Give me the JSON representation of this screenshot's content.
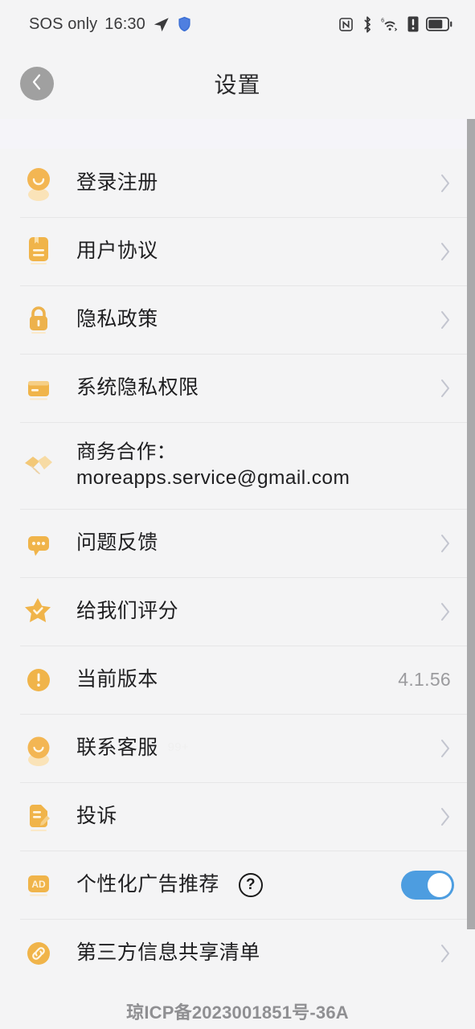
{
  "status_bar": {
    "carrier": "SOS only",
    "time": "16:30",
    "left_icons": [
      "send-icon",
      "shield-icon"
    ],
    "right_icons": [
      "nfc-icon",
      "bluetooth-icon",
      "wifi-6-icon",
      "sim-alert-icon",
      "battery-icon"
    ],
    "wifi_generation": "6"
  },
  "header": {
    "title": "设置",
    "back_icon": "chevron-left-icon"
  },
  "colors": {
    "accent_orange": "#f0b44a",
    "toggle_on": "#4d9de0",
    "page_bg": "#f4f4f5",
    "band_bg": "#f5f4f9",
    "divider": "#e6e6e7",
    "text_primary": "#1f1f21",
    "text_secondary": "#9b9b9e"
  },
  "list": {
    "items": [
      {
        "id": "login-register",
        "label": "登录注册",
        "icon": "avatar-icon",
        "chevron": true
      },
      {
        "id": "user-agreement",
        "label": "用户协议",
        "icon": "document-book-icon",
        "chevron": true
      },
      {
        "id": "privacy-policy",
        "label": "隐私政策",
        "icon": "lock-icon",
        "chevron": true
      },
      {
        "id": "system-privacy-permissions",
        "label": "系统隐私权限",
        "icon": "card-icon",
        "chevron": true
      },
      {
        "id": "business-cooperation",
        "label": "商务合作：moreapps.service@gmail.com",
        "icon": "handshake-icon",
        "chevron": false
      },
      {
        "id": "feedback",
        "label": "问题反馈",
        "icon": "chat-bubble-icon",
        "chevron": true
      },
      {
        "id": "rate-us",
        "label": "给我们评分",
        "icon": "star-check-icon",
        "chevron": true
      },
      {
        "id": "current-version",
        "label": "当前版本",
        "icon": "exclamation-circle-icon",
        "value": "4.1.56",
        "chevron": false
      },
      {
        "id": "contact-support",
        "label": "联系客服",
        "icon": "avatar-icon",
        "badge": "99+",
        "chevron": true
      },
      {
        "id": "complaint",
        "label": "投诉",
        "icon": "edit-document-icon",
        "chevron": true
      },
      {
        "id": "personalized-ads",
        "label": "个性化广告推荐",
        "icon": "ad-icon",
        "help": "?",
        "toggle": true,
        "toggle_on": true,
        "chevron": false
      },
      {
        "id": "third-party-sharing",
        "label": "第三方信息共享清单",
        "icon": "link-icon",
        "chevron": true
      }
    ]
  },
  "footer": {
    "icp_license": "琼ICP备2023001851号-36A"
  }
}
